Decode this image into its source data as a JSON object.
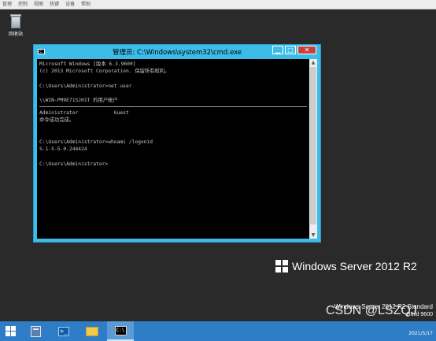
{
  "vm_menu": [
    "管理",
    "控制",
    "视图",
    "热键",
    "设备",
    "帮助"
  ],
  "desktop": {
    "recycle_bin_label": "回收站"
  },
  "cmd_window": {
    "title": "管理员: C:\\Windows\\system32\\cmd.exe",
    "buttons": {
      "minimize": "▁",
      "maximize": "□",
      "close": "✕"
    },
    "console_before_sep": "Microsoft Windows [版本 6.3.9600]\n(c) 2013 Microsoft Corporation. 保留所有权利。\n\nC:\\Users\\Administrator>net user\n\n\\\\WIN-PM9E71SJH1T 的用户帐户\n",
    "console_after_sep": "Administrator            Guest\n命令成功完成。\n\n\nC:\\Users\\Administrator>whoami /logonid\nS-1-5-5-0-244424\n\nC:\\Users\\Administrator>"
  },
  "branding": {
    "product": "Windows Server 2012 R2",
    "version_line": "Windows Server 2012 R2 Standard",
    "build_line": "Build 9600"
  },
  "watermark": "CSDN @LSZQJ",
  "taskbar": {
    "date": "2021/5/17",
    "ps_glyph": ">_",
    "cmd_glyph": "C:\\"
  }
}
